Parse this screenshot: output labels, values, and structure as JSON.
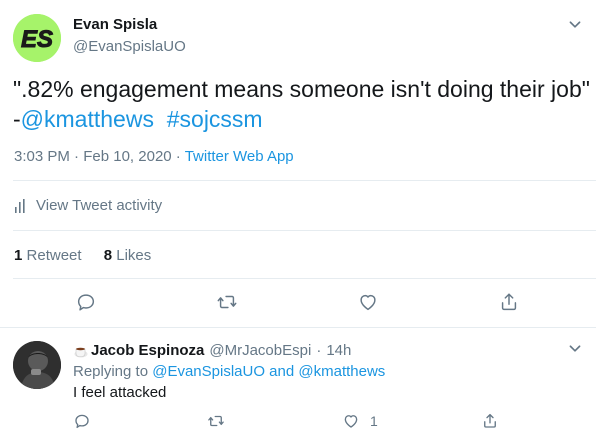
{
  "tweet": {
    "author_name": "Evan Spisla",
    "author_handle": "@EvanSpislaUO",
    "avatar_text": "ES",
    "text_line1": "\".82% engagement means someone isn't doing their job\"",
    "text_prefix": "-",
    "mention": "@kmatthews",
    "hashtag": "#sojcssm",
    "time": "3:03 PM",
    "separator": "·",
    "date": "Feb 10, 2020",
    "source": "Twitter Web App",
    "activity_label": "View Tweet activity",
    "retweet_count": "1",
    "retweet_label": "Retweet",
    "like_count": "8",
    "like_label": "Likes"
  },
  "reply": {
    "author_name": "Jacob Espinoza",
    "author_handle": "@MrJacobEspi",
    "separator": "·",
    "age": "14h",
    "replying_prefix": "Replying to",
    "replying_to_1": "@EvanSpislaUO",
    "replying_and": "and",
    "replying_to_2": "@kmatthews",
    "text": "I feel attacked",
    "like_count": "1"
  },
  "colors": {
    "link": "#1b95e0",
    "secondary_text": "#657786",
    "primary_text": "#14171a",
    "avatar_bg": "#a6f36a",
    "divider": "#e6ecf0"
  },
  "icons": {
    "caret": "chevron-down-icon",
    "reply": "reply-icon",
    "retweet": "retweet-icon",
    "like": "heart-icon",
    "share": "share-icon",
    "activity": "bar-chart-icon",
    "emoji": "coffee-emoji-icon"
  }
}
